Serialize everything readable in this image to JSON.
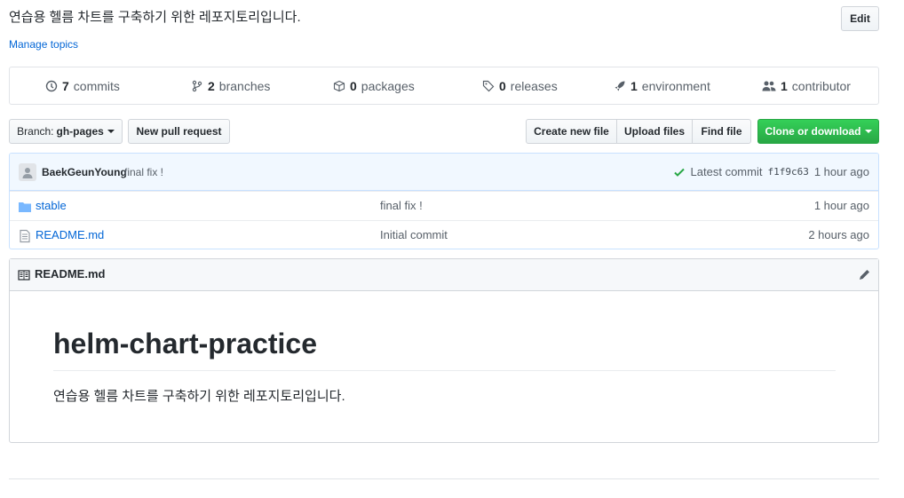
{
  "repo": {
    "description": "연습용 헬름 차트를 구축하기 위한 레포지토리입니다.",
    "edit_label": "Edit",
    "manage_topics_label": "Manage topics"
  },
  "summary": {
    "commits_count": "7",
    "commits_label": "commits",
    "branches_count": "2",
    "branches_label": "branches",
    "packages_count": "0",
    "packages_label": "packages",
    "releases_count": "0",
    "releases_label": "releases",
    "environment_count": "1",
    "environment_label": "environment",
    "contributor_count": "1",
    "contributor_label": "contributor"
  },
  "toolbar": {
    "branch_prefix": "Branch:",
    "branch_name": "gh-pages",
    "new_pull_request": "New pull request",
    "create_new_file": "Create new file",
    "upload_files": "Upload files",
    "find_file": "Find file",
    "clone_or_download": "Clone or download"
  },
  "commit": {
    "author": "BaekGeunYoung",
    "message": "final fix !",
    "latest_label": "Latest commit",
    "sha": "f1f9c63",
    "age": "1 hour ago"
  },
  "files": [
    {
      "name": "stable",
      "type": "dir",
      "message": "final fix !",
      "age": "1 hour ago"
    },
    {
      "name": "README.md",
      "type": "file",
      "message": "Initial commit",
      "age": "2 hours ago"
    }
  ],
  "readme": {
    "filename": "README.md",
    "heading": "helm-chart-practice",
    "body": "연습용 헬름 차트를 구축하기 위한 레포지토리입니다."
  },
  "colors": {
    "link": "#0366d6",
    "success": "#28a745",
    "commit_bar": "#f1f8ff"
  }
}
